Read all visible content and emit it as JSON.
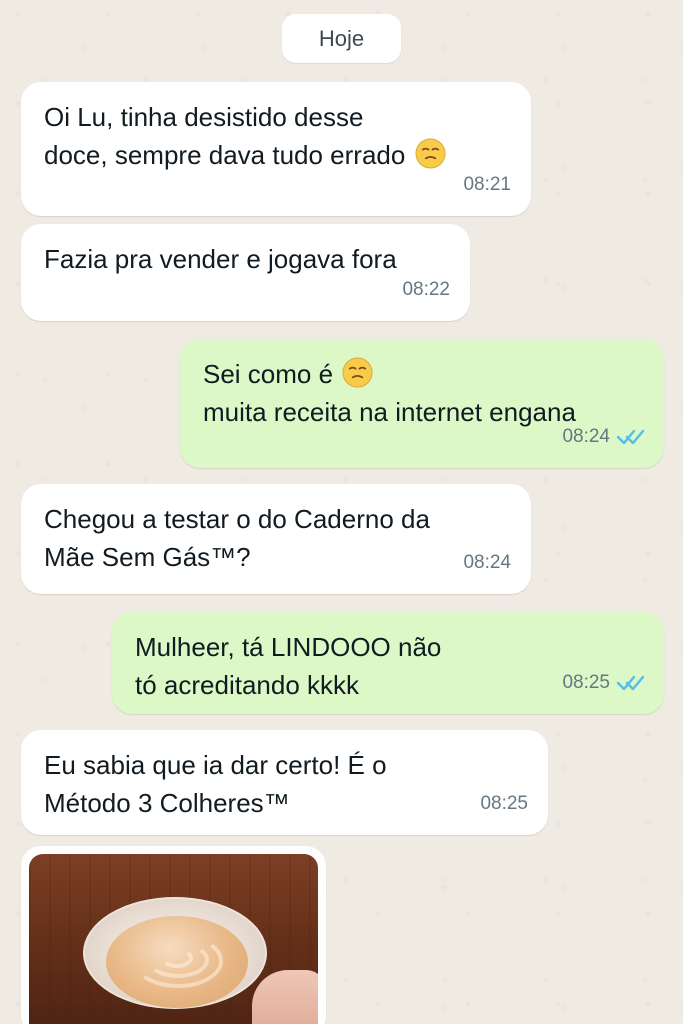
{
  "date_label": "Hoje",
  "messages": [
    {
      "side": "in",
      "lines": [
        "Oi Lu, tinha desistido desse",
        "doce, sempre dava tudo errado"
      ],
      "emoji": "pensive-face-emoji",
      "time": "08:21"
    },
    {
      "side": "in",
      "lines": [
        "Fazia pra vender e jogava fora"
      ],
      "time": "08:22"
    },
    {
      "side": "out",
      "lines": [
        "Sei como é",
        "muita receita na internet engana"
      ],
      "emoji": "pensive-face-emoji",
      "time": "08:24",
      "status": "read"
    },
    {
      "side": "in",
      "lines": [
        "Chegou a testar o do Caderno da",
        "Mãe Sem Gás™?"
      ],
      "time": "08:24"
    },
    {
      "side": "out",
      "lines": [
        "Mulheer, tá LINDOOO não",
        "tó acreditando kkkk"
      ],
      "time": "08:25",
      "status": "read"
    },
    {
      "side": "in",
      "lines": [
        "Eu sabia que ia dar certo! É o",
        "Método 3 Colheres™"
      ],
      "time": "08:25"
    }
  ],
  "colors": {
    "incoming_bubble": "#ffffff",
    "outgoing_bubble": "#dcf8c6",
    "chat_background": "#efeae2",
    "read_ticks": "#53bdeb"
  },
  "photo": {
    "icon": "photo-message"
  }
}
